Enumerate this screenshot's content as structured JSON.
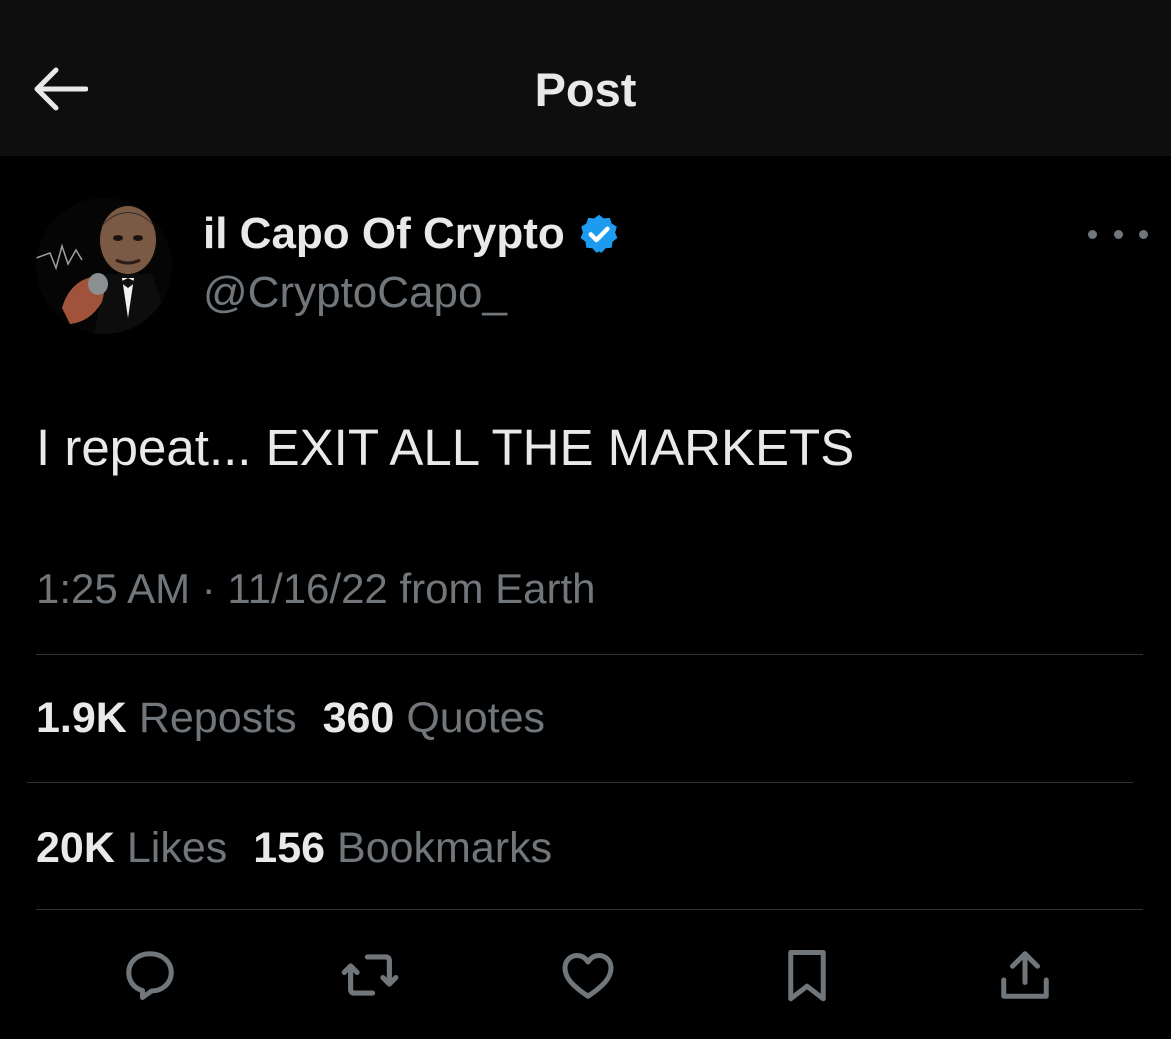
{
  "header": {
    "title": "Post",
    "back_icon": "arrow-left-icon"
  },
  "author": {
    "display_name": "il Capo Of Crypto",
    "handle": "@CryptoCapo_",
    "verified": true,
    "verified_color": "#1d9bf0"
  },
  "post": {
    "text": "I repeat... EXIT ALL THE MARKETS",
    "timestamp": "1:25 AM · 11/16/22 from Earth"
  },
  "stats": {
    "reposts_count": "1.9K",
    "reposts_label": "Reposts",
    "quotes_count": "360",
    "quotes_label": "Quotes",
    "likes_count": "20K",
    "likes_label": "Likes",
    "bookmarks_count": "156",
    "bookmarks_label": "Bookmarks"
  },
  "actions": [
    "reply-icon",
    "repost-icon",
    "like-icon",
    "bookmark-icon",
    "share-icon"
  ],
  "colors": {
    "background": "#000000",
    "header_background": "#0e0e0e",
    "text_primary": "#e7e9ea",
    "text_secondary": "#71767b",
    "divider": "#2f3336"
  }
}
